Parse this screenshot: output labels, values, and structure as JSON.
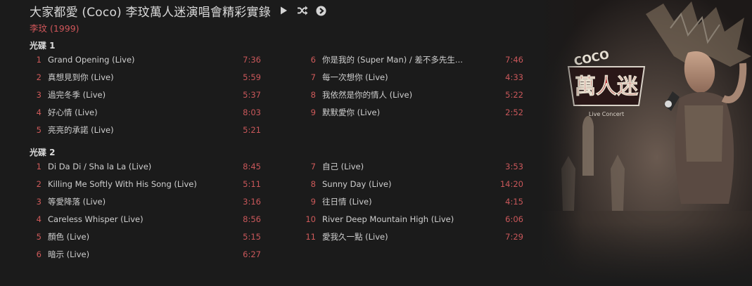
{
  "header": {
    "album_title": "大家都愛 (Coco) 李玟萬人迷演唱會精彩實錄",
    "artist_year": "李玟 (1999)",
    "icons": [
      "play-icon",
      "shuffle-icon",
      "next-circle-icon"
    ]
  },
  "discs": [
    {
      "label": "光碟 1",
      "left": [
        {
          "num": "1",
          "title": "Grand Opening (Live)",
          "duration": "7:36"
        },
        {
          "num": "2",
          "title": "真想見到你 (Live)",
          "duration": "5:59"
        },
        {
          "num": "3",
          "title": "過完冬季 (Live)",
          "duration": "5:37"
        },
        {
          "num": "4",
          "title": "好心情 (Live)",
          "duration": "8:03"
        },
        {
          "num": "5",
          "title": "亮亮的承諾 (Live)",
          "duration": "5:21"
        }
      ],
      "right": [
        {
          "num": "6",
          "title": "你是我的 (Super Man) / 差不多先生...",
          "duration": "7:46"
        },
        {
          "num": "7",
          "title": "每一次想你 (Live)",
          "duration": "4:33"
        },
        {
          "num": "8",
          "title": "我依然是你的情人 (Live)",
          "duration": "5:22"
        },
        {
          "num": "9",
          "title": "默默愛你 (Live)",
          "duration": "2:52"
        }
      ]
    },
    {
      "label": "光碟 2",
      "left": [
        {
          "num": "1",
          "title": "Di Da Di / Sha la La (Live)",
          "duration": "8:45"
        },
        {
          "num": "2",
          "title": "Killing Me Softly With His Song (Live)",
          "duration": "5:11"
        },
        {
          "num": "3",
          "title": "等愛降落 (Live)",
          "duration": "3:16"
        },
        {
          "num": "4",
          "title": "Careless Whisper (Live)",
          "duration": "8:56"
        },
        {
          "num": "5",
          "title": "顏色 (Live)",
          "duration": "5:15"
        },
        {
          "num": "6",
          "title": "暗示 (Live)",
          "duration": "6:27"
        }
      ],
      "right": [
        {
          "num": "7",
          "title": "自己 (Live)",
          "duration": "3:53"
        },
        {
          "num": "8",
          "title": "Sunny Day (Live)",
          "duration": "14:20"
        },
        {
          "num": "9",
          "title": "往日情 (Live)",
          "duration": "4:15"
        },
        {
          "num": "10",
          "title": "River Deep Mountain High (Live)",
          "duration": "6:06"
        },
        {
          "num": "11",
          "title": "愛我久一點 (Live)",
          "duration": "7:29"
        }
      ]
    }
  ],
  "cover": {
    "logo_text": "萬人迷",
    "logo_sub": "COCO",
    "logo_small": "Live Concert",
    "colors": {
      "accent": "#cf5a5a",
      "logo_red": "#b01e24"
    }
  }
}
